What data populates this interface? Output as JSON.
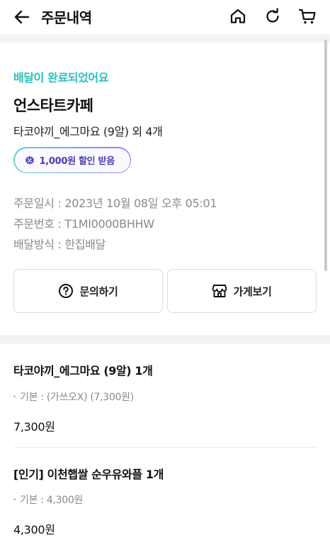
{
  "header": {
    "title": "주문내역",
    "back_icon": "arrow-left-icon",
    "home_icon": "home-icon",
    "refresh_icon": "refresh-icon",
    "cart_icon": "cart-icon"
  },
  "order": {
    "status": "배달이 완료되었어요",
    "store_name": "언스타트카페",
    "summary": "타코야끼_에그마요 (9알) 외 4개",
    "discount_badge": "1,000원 할인 받음",
    "order_date": "주문일시 : 2023년 10월 08일 오후 05:01",
    "order_number": "주문번호 : T1MI0000BHHW",
    "delivery_method": "배달방식 : 한집배달",
    "inquiry_button": "문의하기",
    "store_button": "가게보기"
  },
  "items": [
    {
      "name": "타코야끼_에그마요 (9알) 1개",
      "option": "기본 : (가쓰오X) (7,300원)",
      "price": "7,300원"
    },
    {
      "name": "[인기] 이천햅쌀 순우유와플 1개",
      "option": "기본 : 4,300원",
      "price": "4,300원"
    }
  ],
  "colors": {
    "status": "#2ac1bc",
    "badge_text": "#4a3fb3",
    "badge_gradient_start": "#5bd6d1",
    "badge_gradient_end": "#8b7cf6"
  }
}
